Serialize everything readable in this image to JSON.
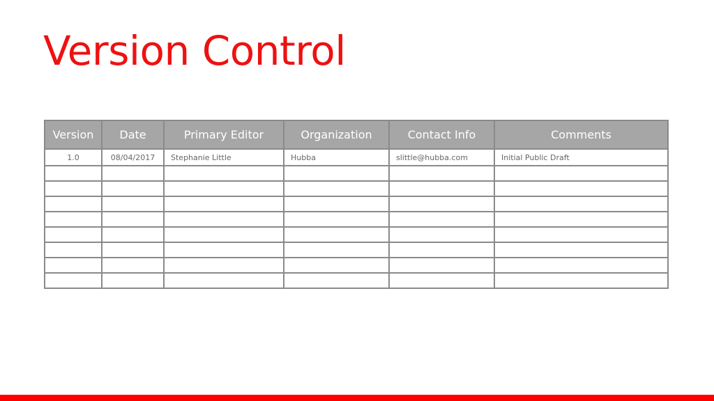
{
  "title": "Version Control",
  "table": {
    "headers": [
      "Version",
      "Date",
      "Primary Editor",
      "Organization",
      "Contact Info",
      "Comments"
    ],
    "rows": [
      [
        "1.0",
        "08/04/2017",
        "Stephanie Little",
        "Hubba",
        "slittle@hubba.com",
        "Initial Public Draft"
      ],
      [
        "",
        "",
        "",
        "",
        "",
        ""
      ],
      [
        "",
        "",
        "",
        "",
        "",
        ""
      ],
      [
        "",
        "",
        "",
        "",
        "",
        ""
      ],
      [
        "",
        "",
        "",
        "",
        "",
        ""
      ],
      [
        "",
        "",
        "",
        "",
        "",
        ""
      ],
      [
        "",
        "",
        "",
        "",
        "",
        ""
      ],
      [
        "",
        "",
        "",
        "",
        "",
        ""
      ],
      [
        "",
        "",
        "",
        "",
        "",
        ""
      ]
    ]
  },
  "colors": {
    "accent": "#ff0000",
    "header_bg": "#a6a6a6",
    "border": "#8a8a8a"
  }
}
